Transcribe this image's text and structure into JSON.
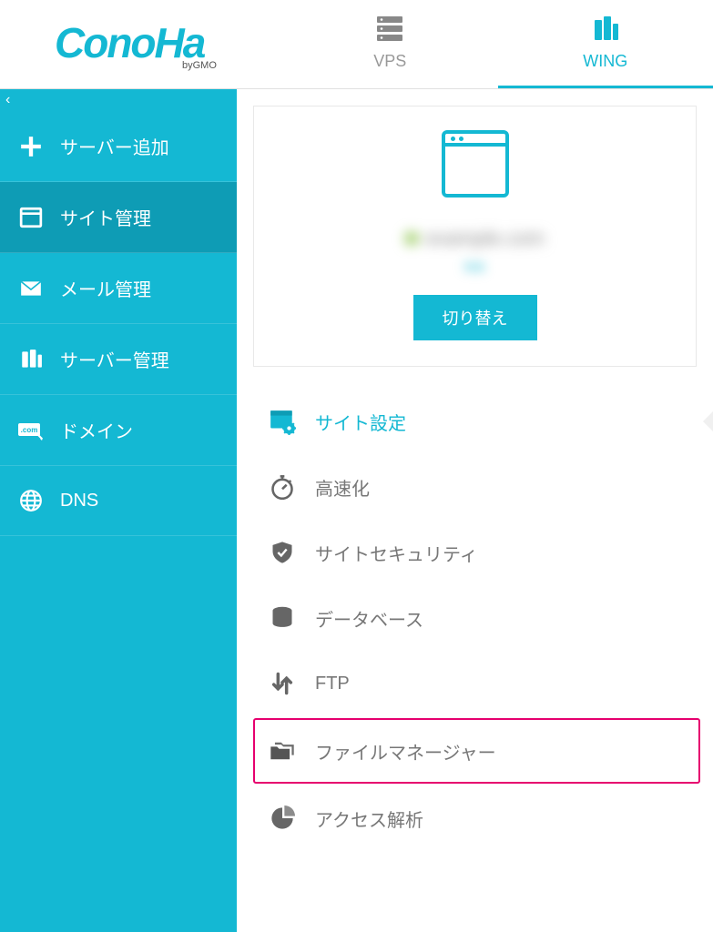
{
  "logo": {
    "text": "ConoHa",
    "sub": "byGMO"
  },
  "tabs": [
    {
      "label": "VPS",
      "active": false
    },
    {
      "label": "WING",
      "active": true
    }
  ],
  "sidebar": {
    "items": [
      {
        "icon": "plus",
        "label": "サーバー追加"
      },
      {
        "icon": "window",
        "label": "サイト管理"
      },
      {
        "icon": "mail",
        "label": "メール管理"
      },
      {
        "icon": "servers",
        "label": "サーバー管理"
      },
      {
        "icon": "domain",
        "label": "ドメイン"
      },
      {
        "icon": "globe",
        "label": "DNS"
      }
    ],
    "active_index": 1
  },
  "site_card": {
    "domain_blur": "example.com",
    "sub_blur": "link",
    "switch_label": "切り替え"
  },
  "submenu": {
    "items": [
      {
        "label": "サイト設定",
        "selected": true
      },
      {
        "label": "高速化"
      },
      {
        "label": "サイトセキュリティ"
      },
      {
        "label": "データベース"
      },
      {
        "label": "FTP"
      },
      {
        "label": "ファイルマネージャー",
        "highlight": true
      },
      {
        "label": "アクセス解析"
      }
    ]
  }
}
